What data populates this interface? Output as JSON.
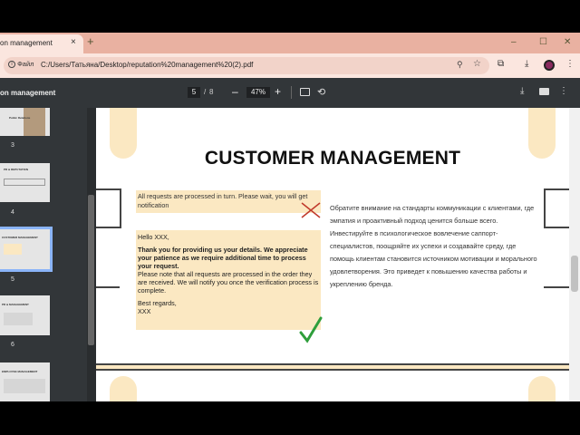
{
  "browser": {
    "tab_title": "on management",
    "tab_close": "×",
    "new_tab": "+",
    "window_controls": [
      "–",
      "☐",
      "✕"
    ],
    "site_chip_label": "Файл",
    "url": "C:/Users/Татьяна/Desktop/reputation%20management%20(2).pdf",
    "icons": [
      "zoom-icon",
      "star-icon",
      "extensions-icon",
      "download-icon",
      "profile-avatar",
      "menu-icon"
    ]
  },
  "pdf_toolbar": {
    "title": "on management",
    "page_current": "5",
    "page_separator": "/",
    "page_total": "8",
    "zoom_out": "–",
    "zoom_value": "47%",
    "zoom_in": "+"
  },
  "sidebar": {
    "thumbnails": [
      {
        "page": "3",
        "label": "Public Relations"
      },
      {
        "page": "4",
        "label": "PR & REPUTATION"
      },
      {
        "page": "5",
        "label": "CUSTOMER MANAGEMENT",
        "selected": true
      },
      {
        "page": "6",
        "label": "PR & MANAGEMENT"
      },
      {
        "page": "7",
        "label": "EMPLOYEE MANAGEMENT"
      }
    ]
  },
  "page": {
    "heading": "CUSTOMER MANAGEMENT",
    "notice": "All requests are processed in turn. Please wait, you will get notification",
    "email": {
      "greeting": "Hello XXX,",
      "bold": "Thank you for providing us your details. We appreciate your patience as we require additional time to process your request.",
      "body": "Please note that all requests are processed in the order they are received. We will notify you once the verification process is complete.",
      "signoff": "Best regards,",
      "name": "XXX"
    },
    "russian_text": "Обратите внимание на стандарты коммуникации с клиентами, где эмпатия и проактивный подход ценится больше всего. Инвестируйте в психологическое вовлечение саппорт-специалистов, поощряйте их успехи и создавайте среду, где помощь клиентам становится источником мотивации и морального удовлетворения. Это приведет к повышению качества работы и укреплению бренда."
  },
  "colors": {
    "accent_beige": "#fbe8c2",
    "viewer_dark": "#323639",
    "tab_strip": "#e9b1a1",
    "cross_red": "#c0392b",
    "check_green": "#2e9e3b"
  }
}
